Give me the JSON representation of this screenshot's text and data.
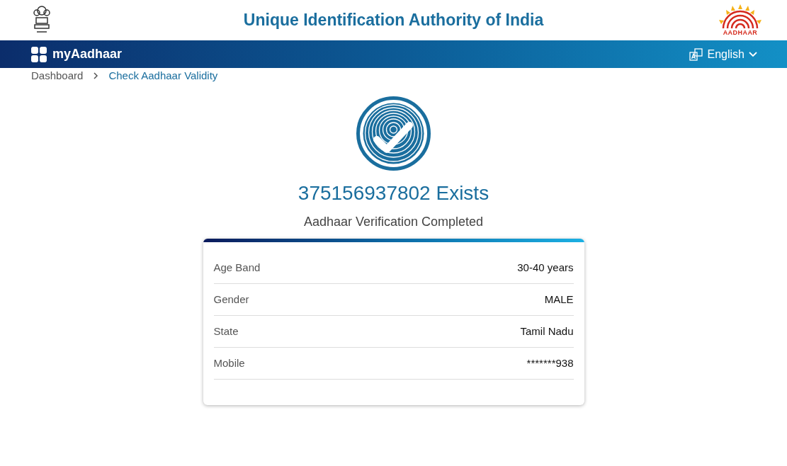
{
  "header": {
    "title": "Unique Identification Authority of India",
    "logo_text": "AADHAAR"
  },
  "navbar": {
    "brand": "myAadhaar",
    "language": "English"
  },
  "breadcrumb": [
    {
      "label": "Dashboard",
      "selected": false
    },
    {
      "label": "Check Aadhaar Validity",
      "selected": true
    }
  ],
  "result": {
    "heading": "375156937802 Exists",
    "subtitle": "Aadhaar Verification Completed"
  },
  "details": [
    {
      "label": "Age Band",
      "value": "30-40 years"
    },
    {
      "label": "Gender",
      "value": "MALE"
    },
    {
      "label": "State",
      "value": "Tamil Nadu"
    },
    {
      "label": "Mobile",
      "value": "*******938"
    }
  ]
}
